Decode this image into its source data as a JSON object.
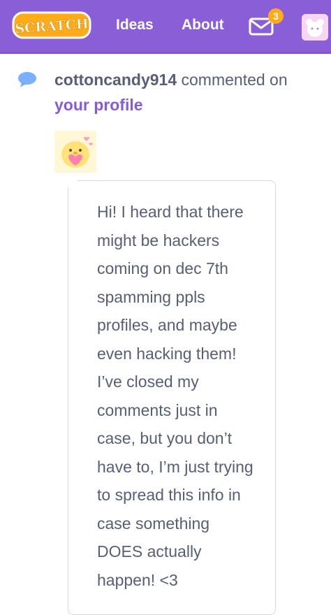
{
  "nav": {
    "logo_text": "SCRATCH",
    "ideas_label": "Ideas",
    "about_label": "About",
    "messages_count": "3"
  },
  "notification": {
    "username": "cottoncandy914",
    "action": " commented on",
    "target": "your profile",
    "comment_text": "Hi! I heard that there\nmight be hackers\ncoming on dec 7th\nspamming ppls\nprofiles, and maybe\neven hacking them!\nI’ve closed my\ncomments just in\ncase, but you don’t\nhave to, I’m just trying\nto spread this info in\ncase something\nDOES actually\nhappen! <3"
  },
  "colors": {
    "nav_bg": "#8a5ed6",
    "accent": "#855cd6",
    "text": "#575e75",
    "badge": "#ffab1a",
    "logo_orange": "#ffab1a"
  },
  "icons": [
    "scratch-logo",
    "envelope-icon",
    "avatar",
    "speech-bubble-icon"
  ]
}
